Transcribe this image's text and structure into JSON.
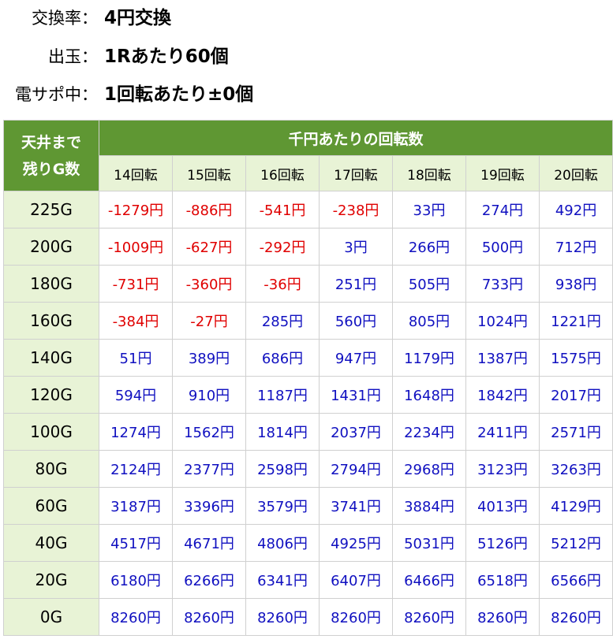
{
  "info": [
    {
      "label": "交換率：",
      "value": "4円交換"
    },
    {
      "label": "出玉：",
      "value": "1Rあたり60個"
    },
    {
      "label": "電サポ中：",
      "value": "1回転あたり±0個"
    }
  ],
  "table": {
    "corner": [
      "天井まで",
      "残りG数"
    ],
    "group_header": "千円あたりの回転数",
    "columns": [
      "14回転",
      "15回転",
      "16回転",
      "17回転",
      "18回転",
      "19回転",
      "20回転"
    ],
    "rows": [
      {
        "label": "225G",
        "values": [
          "-1279円",
          "-886円",
          "-541円",
          "-238円",
          "33円",
          "274円",
          "492円"
        ]
      },
      {
        "label": "200G",
        "values": [
          "-1009円",
          "-627円",
          "-292円",
          "3円",
          "266円",
          "500円",
          "712円"
        ]
      },
      {
        "label": "180G",
        "values": [
          "-731円",
          "-360円",
          "-36円",
          "251円",
          "505円",
          "733円",
          "938円"
        ]
      },
      {
        "label": "160G",
        "values": [
          "-384円",
          "-27円",
          "285円",
          "560円",
          "805円",
          "1024円",
          "1221円"
        ]
      },
      {
        "label": "140G",
        "values": [
          "51円",
          "389円",
          "686円",
          "947円",
          "1179円",
          "1387円",
          "1575円"
        ]
      },
      {
        "label": "120G",
        "values": [
          "594円",
          "910円",
          "1187円",
          "1431円",
          "1648円",
          "1842円",
          "2017円"
        ]
      },
      {
        "label": "100G",
        "values": [
          "1274円",
          "1562円",
          "1814円",
          "2037円",
          "2234円",
          "2411円",
          "2571円"
        ]
      },
      {
        "label": "80G",
        "values": [
          "2124円",
          "2377円",
          "2598円",
          "2794円",
          "2968円",
          "3123円",
          "3263円"
        ]
      },
      {
        "label": "60G",
        "values": [
          "3187円",
          "3396円",
          "3579円",
          "3741円",
          "3884円",
          "4013円",
          "4129円"
        ]
      },
      {
        "label": "40G",
        "values": [
          "4517円",
          "4671円",
          "4806円",
          "4925円",
          "5031円",
          "5126円",
          "5212円"
        ]
      },
      {
        "label": "20G",
        "values": [
          "6180円",
          "6266円",
          "6341円",
          "6407円",
          "6466円",
          "6518円",
          "6566円"
        ]
      },
      {
        "label": "0G",
        "values": [
          "8260円",
          "8260円",
          "8260円",
          "8260円",
          "8260円",
          "8260円",
          "8260円"
        ]
      }
    ]
  },
  "colors": {
    "header_green": "#5f9733",
    "light_green": "#e8f3d6",
    "negative_text": "#e00000",
    "positive_text": "#1010c0"
  }
}
